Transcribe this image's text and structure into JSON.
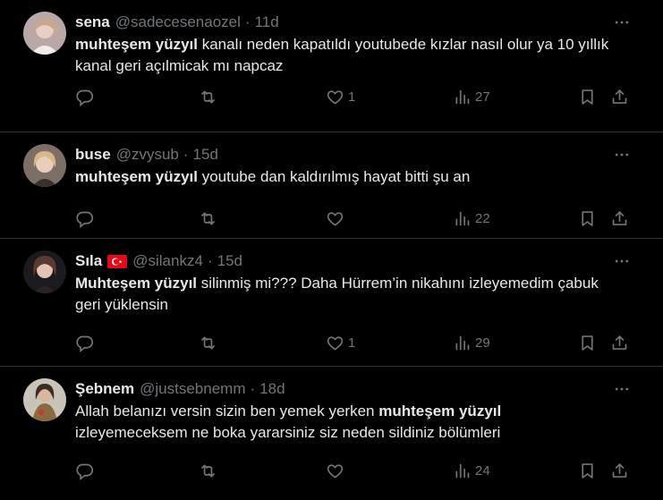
{
  "tweets": [
    {
      "name": "sena",
      "handle": "@sadecesenaozel",
      "separator": "·",
      "date": "11d",
      "flag": "",
      "text": [
        {
          "t": "muhteşem yüzyıl",
          "b": true
        },
        {
          "t": " kanalı neden kapatıldı youtubede kızlar nasıl olur ya 10 yıllık kanal geri açılmicak mı napcaz",
          "b": false
        }
      ],
      "replies": "",
      "reposts": "",
      "likes": "1",
      "views": "27"
    },
    {
      "name": "buse",
      "handle": "@zvysub",
      "separator": "·",
      "date": "15d",
      "flag": "",
      "text": [
        {
          "t": "muhteşem yüzyıl",
          "b": true
        },
        {
          "t": " youtube dan kaldırılmış hayat bitti şu an",
          "b": false
        }
      ],
      "replies": "",
      "reposts": "",
      "likes": "",
      "views": "22"
    },
    {
      "name": "Sıla",
      "handle": "@silankz4",
      "separator": "·",
      "date": "15d",
      "flag": "turkey-flag",
      "text": [
        {
          "t": "Muhteşem yüzyıl",
          "b": true
        },
        {
          "t": " silinmiş mi??? Daha Hürrem’in nikahını izleyemedim çabuk geri yüklensin",
          "b": false
        }
      ],
      "replies": "",
      "reposts": "",
      "likes": "1",
      "views": "29"
    },
    {
      "name": "Şebnem",
      "handle": "@justsebnemm",
      "separator": "·",
      "date": "18d",
      "flag": "",
      "text": [
        {
          "t": "Allah belanızı versin sizin ben yemek yerken ",
          "b": false
        },
        {
          "t": "muhteşem yüzyıl",
          "b": true
        },
        {
          "t": " izleyemeceksem ne boka yararsiniz siz neden sildiniz bölümleri",
          "b": false
        }
      ],
      "replies": "",
      "reposts": "",
      "likes": "",
      "views": "24"
    }
  ],
  "colors": {
    "background": "#000000",
    "text": "#e7e9ea",
    "muted": "#71767b",
    "divider": "#2f3336"
  },
  "icons": [
    "more-icon",
    "reply-icon",
    "repost-icon",
    "like-icon",
    "views-icon",
    "bookmark-icon",
    "share-icon"
  ]
}
